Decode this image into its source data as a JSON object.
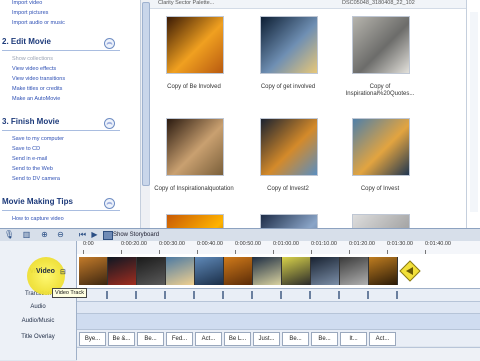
{
  "taskpane": {
    "capture_links": [
      "Import video",
      "Import pictures",
      "Import audio or music"
    ],
    "edit_section": {
      "title": "2. Edit Movie",
      "links": [
        "Show collections",
        "View video effects",
        "View video transitions",
        "Make titles or credits",
        "Make an AutoMovie"
      ],
      "gray_index": 0
    },
    "finish_section": {
      "title": "3. Finish Movie",
      "links": [
        "Save to my computer",
        "Save to CD",
        "Send in e-mail",
        "Send to the Web",
        "Send to DV camera"
      ]
    },
    "tips_section": {
      "title": "Movie Making Tips",
      "links": [
        "How to capture video"
      ]
    }
  },
  "collection": {
    "strip_left": "Clarity Sector Palette...",
    "strip_right": "DSC05048_3180408_22_102",
    "clips": [
      {
        "caption": "Copy of Be Involved",
        "colors": [
          "#3a1a05",
          "#f0a020",
          "#b85a10"
        ]
      },
      {
        "caption": "Copy of get involved",
        "colors": [
          "#0d1e33",
          "#6f8fb3",
          "#e7c778"
        ]
      },
      {
        "caption": "Copy of Inspirational%20Quotes...",
        "colors": [
          "#b6b4ad",
          "#6c6c6a",
          "#e3e1db"
        ]
      },
      {
        "caption": "Copy of Inspirationalquotation",
        "colors": [
          "#2a1a10",
          "#c9a070",
          "#7a5f3a"
        ]
      },
      {
        "caption": "Copy of Invest2",
        "colors": [
          "#1b2230",
          "#d48a2a",
          "#5a8ec0"
        ]
      },
      {
        "caption": "Copy of Invest",
        "colors": [
          "#4f7fa8",
          "#e2a440",
          "#203650"
        ]
      },
      {
        "caption": "",
        "colors": [
          "#c85a06",
          "#ffb300",
          "#6a2a02"
        ]
      },
      {
        "caption": "",
        "colors": [
          "#1e2d48",
          "#8aa5c8",
          "#41577a"
        ]
      },
      {
        "caption": "",
        "colors": [
          "#ddd",
          "#aaa",
          "#888"
        ]
      }
    ]
  },
  "toolbar": {
    "show_storyboard": "Show Storyboard",
    "icons": [
      "narrate-icon",
      "audio-levels-icon",
      "zoom-in-icon",
      "zoom-out-icon",
      "rewind-icon",
      "play-icon"
    ]
  },
  "timeline": {
    "labels": {
      "video": "Video",
      "transition": "Transition",
      "audio": "Audio",
      "audio_music": "Audio/Music",
      "title_overlay": "Title Overlay"
    },
    "ruler_ticks": [
      "0:00",
      "0:00:20.00",
      "0:00:30.00",
      "0:00:40.00",
      "0:00:50.00",
      "0:01:00.00",
      "0:01:10.00",
      "0:01:20.00",
      "0:01:30.00",
      "0:01:40.00"
    ],
    "tooltip": "Video Track",
    "video_clips": [
      [
        "#c37b2a",
        "#3d2610"
      ],
      [
        "#0e1722",
        "#a12d20"
      ],
      [
        "#1a1a1a",
        "#5a5a5a"
      ],
      [
        "#4c7aa3",
        "#f0d090"
      ],
      [
        "#5f89b8",
        "#1a2e48"
      ],
      [
        "#d07a1a",
        "#5a2b08"
      ],
      [
        "#1e2e44",
        "#d9d2a0"
      ],
      [
        "#d8d24a",
        "#2a2a2a"
      ],
      [
        "#182231",
        "#7c8fa8"
      ],
      [
        "#3a3a3a",
        "#b0b0b0"
      ],
      [
        "#bf7d20",
        "#2a1a08"
      ]
    ],
    "title_clips": [
      "Bye...",
      "Be &...",
      "Be...",
      "Fed...",
      "Act...",
      "Be L...",
      "Just...",
      "Be...",
      "Be...",
      "It...",
      "Act..."
    ]
  }
}
